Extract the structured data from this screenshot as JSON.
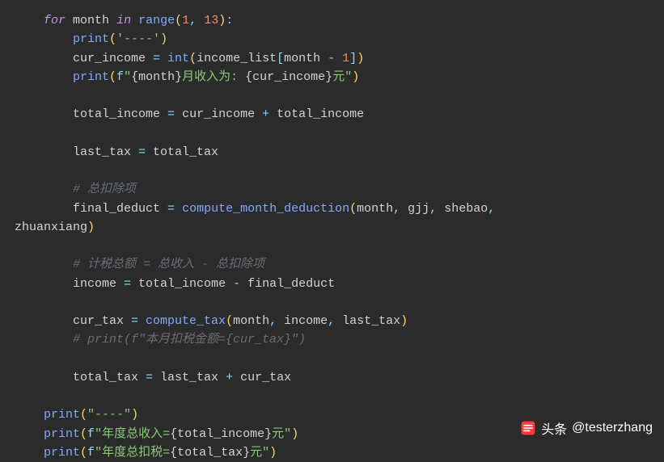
{
  "code": {
    "l1": {
      "kw1": "for",
      "var1": "month",
      "kw2": "in",
      "fn": "range",
      "p1": "(",
      "n1": "1",
      "c": ",",
      "sp": " ",
      "n2": "13",
      "p2": ")",
      "colon": ":"
    },
    "l2": {
      "fn": "print",
      "p1": "(",
      "str": "'----'",
      "p2": ")"
    },
    "l3": {
      "var1": "cur_income",
      "eq": " = ",
      "fn": "int",
      "p1": "(",
      "var2": "income_list",
      "b1": "[",
      "var3": "month",
      "op": " - ",
      "n": "1",
      "b2": "]",
      "p2": ")"
    },
    "l4": {
      "fn": "print",
      "p1": "(",
      "pf": "f",
      "q1": "\"",
      "b1": "{",
      "v1": "month",
      "b2": "}",
      "t1": "月收入为: ",
      "b3": "{",
      "v2": "cur_income",
      "b4": "}",
      "t2": "元",
      "q2": "\"",
      "p2": ")"
    },
    "l5": {
      "var1": "total_income",
      "eq": " = ",
      "var2": "cur_income",
      "op": " + ",
      "var3": "total_income"
    },
    "l6": {
      "var1": "last_tax",
      "eq": " = ",
      "var2": "total_tax"
    },
    "l7": {
      "cmt": "# 总扣除项"
    },
    "l8": {
      "var1": "final_deduct",
      "eq": " = ",
      "fn": "compute_month_deduction",
      "p1": "(",
      "a1": "month",
      "c1": ", ",
      "a2": "gjj",
      "c2": ", ",
      "a3": "shebao",
      "c3": ", "
    },
    "l8b": {
      "a4": "zhuanxiang",
      "p2": ")"
    },
    "l9": {
      "cmt": "# 计税总额 = 总收入 - 总扣除项"
    },
    "l10": {
      "var1": "income",
      "eq": " = ",
      "var2": "total_income",
      "op": " - ",
      "var3": "final_deduct"
    },
    "l11": {
      "var1": "cur_tax",
      "eq": " = ",
      "fn": "compute_tax",
      "p1": "(",
      "a1": "month",
      "c1": ", ",
      "a2": "income",
      "c2": ", ",
      "a3": "last_tax",
      "p2": ")"
    },
    "l12": {
      "cmt": "# print(f\"本月扣税金额={cur_tax}\")"
    },
    "l13": {
      "var1": "total_tax",
      "eq": " = ",
      "var2": "last_tax",
      "op": " + ",
      "var3": "cur_tax"
    },
    "l14": {
      "fn": "print",
      "p1": "(",
      "str": "\"----\"",
      "p2": ")"
    },
    "l15": {
      "fn": "print",
      "p1": "(",
      "pf": "f",
      "q1": "\"",
      "t1": "年度总收入=",
      "b1": "{",
      "v1": "total_income",
      "b2": "}",
      "t2": "元",
      "q2": "\"",
      "p2": ")"
    },
    "l16": {
      "fn": "print",
      "p1": "(",
      "pf": "f",
      "q1": "\"",
      "t1": "年度总扣税=",
      "b1": "{",
      "v1": "total_tax",
      "b2": "}",
      "t2": "元",
      "q2": "\"",
      "p2": ")"
    }
  },
  "watermark": {
    "label": "头条",
    "handle": "@testerzhang"
  }
}
